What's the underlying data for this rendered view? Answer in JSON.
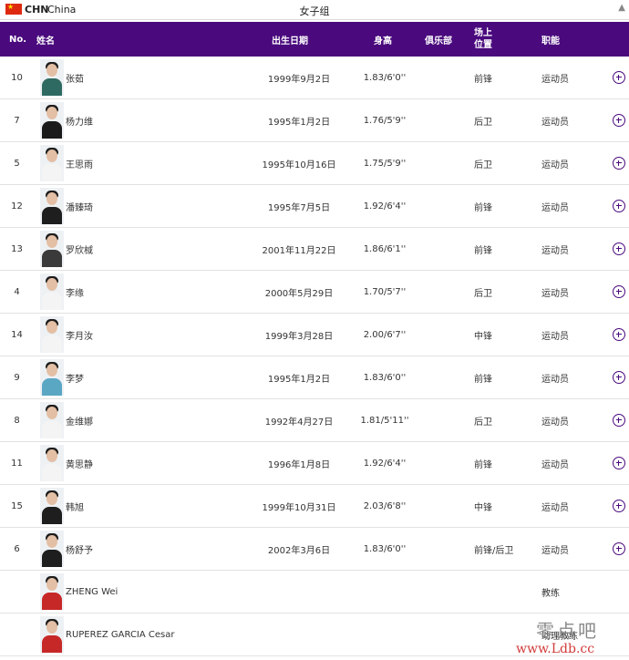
{
  "topbar": {
    "country_code": "CHN",
    "country_name": "China",
    "group_title": "女子组",
    "flag_color": "#de2910"
  },
  "header": {
    "no": "No.",
    "name": "姓名",
    "dob": "出生日期",
    "height": "身高",
    "club": "俱乐部",
    "position_line1": "场上",
    "position_line2": "位置",
    "role": "职能",
    "bg_color": "#4a0a7e"
  },
  "players": [
    {
      "no": "10",
      "name": "张茹",
      "dob": "1999年9月2日",
      "height": "1.83/6'0''",
      "position": "前锋",
      "role": "运动员",
      "shirt": "#2f6a62"
    },
    {
      "no": "7",
      "name": "杨力维",
      "dob": "1995年1月2日",
      "height": "1.76/5'9''",
      "position": "后卫",
      "role": "运动员",
      "shirt": "#1a1a1a"
    },
    {
      "no": "5",
      "name": "王思雨",
      "dob": "1995年10月16日",
      "height": "1.75/5'9''",
      "position": "后卫",
      "role": "运动员",
      "shirt": "#f4f4f4"
    },
    {
      "no": "12",
      "name": "潘臻琦",
      "dob": "1995年7月5日",
      "height": "1.92/6'4''",
      "position": "前锋",
      "role": "运动员",
      "shirt": "#1e1e1e"
    },
    {
      "no": "13",
      "name": "罗欣棫",
      "dob": "2001年11月22日",
      "height": "1.86/6'1''",
      "position": "前锋",
      "role": "运动员",
      "shirt": "#3a3a3a"
    },
    {
      "no": "4",
      "name": "李缘",
      "dob": "2000年5月29日",
      "height": "1.70/5'7''",
      "position": "后卫",
      "role": "运动员",
      "shirt": "#f4f4f4"
    },
    {
      "no": "14",
      "name": "李月汝",
      "dob": "1999年3月28日",
      "height": "2.00/6'7''",
      "position": "中锋",
      "role": "运动员",
      "shirt": "#f4f4f4"
    },
    {
      "no": "9",
      "name": "李梦",
      "dob": "1995年1月2日",
      "height": "1.83/6'0''",
      "position": "前锋",
      "role": "运动员",
      "shirt": "#5aa7c4"
    },
    {
      "no": "8",
      "name": "金维娜",
      "dob": "1992年4月27日",
      "height": "1.81/5'11''",
      "position": "后卫",
      "role": "运动员",
      "shirt": "#f4f4f4"
    },
    {
      "no": "11",
      "name": "黄思静",
      "dob": "1996年1月8日",
      "height": "1.92/6'4''",
      "position": "前锋",
      "role": "运动员",
      "shirt": "#f4f4f4"
    },
    {
      "no": "15",
      "name": "韩旭",
      "dob": "1999年10月31日",
      "height": "2.03/6'8''",
      "position": "中锋",
      "role": "运动员",
      "shirt": "#1e1e1e"
    },
    {
      "no": "6",
      "name": "杨舒予",
      "dob": "2002年3月6日",
      "height": "1.83/6'0''",
      "position": "前锋/后卫",
      "role": "运动员",
      "shirt": "#1e1e1e"
    }
  ],
  "coaches": [
    {
      "name": "ZHENG Wei",
      "role": "教练",
      "shirt": "#c62828"
    },
    {
      "name": "RUPEREZ GARCIA Cesar",
      "role": "助理教练",
      "shirt": "#c62828"
    }
  ],
  "icons": {
    "add": "plus-circle-icon",
    "flag": "china-flag-icon",
    "scroll": "scroll-up-arrow-icon"
  },
  "watermark": {
    "cn": "零点吧",
    "url": "www.Ldb.cc"
  }
}
